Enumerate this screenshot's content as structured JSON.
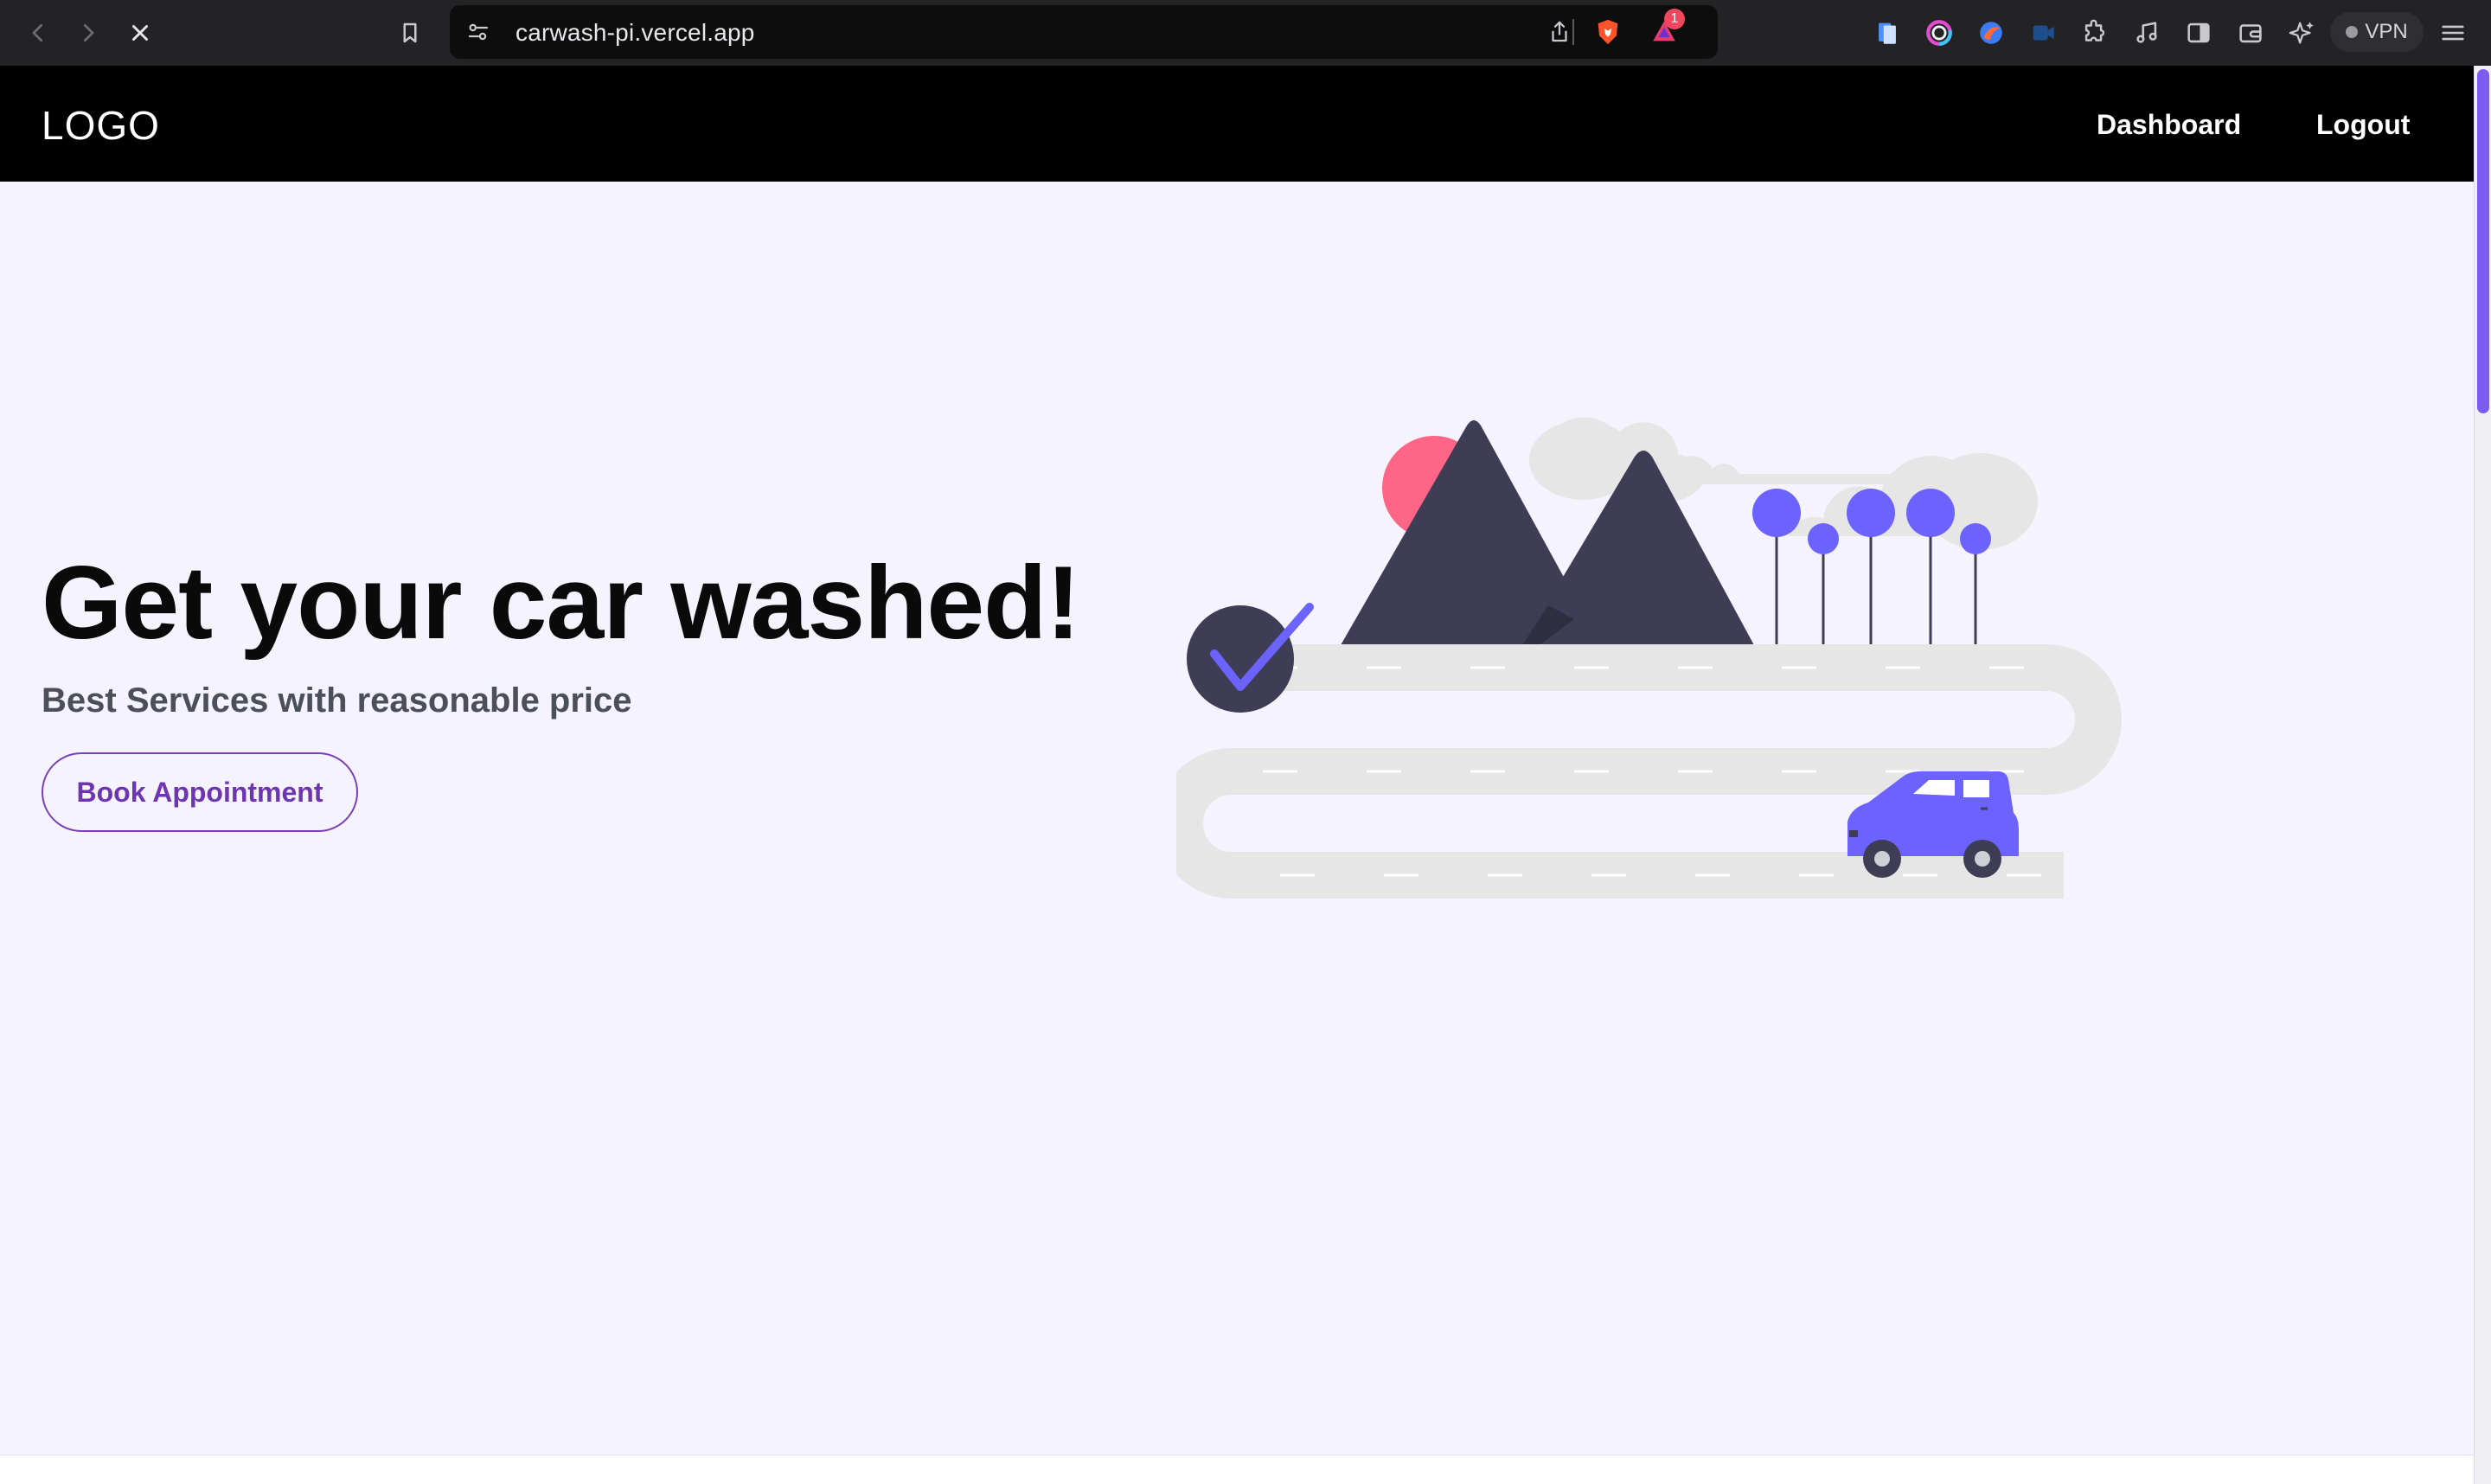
{
  "browser": {
    "url": "carwash-pi.vercel.app",
    "notification_count": "1",
    "vpn_label": "VPN",
    "icons": [
      "back-icon",
      "forward-icon",
      "stop-icon",
      "bookmark-icon",
      "site-settings-icon",
      "share-icon",
      "brave-shields-icon",
      "brave-rewards-icon",
      "extension-files-icon",
      "extension-color-icon",
      "extension-browser-icon",
      "extension-video-icon",
      "extensions-puzzle-icon",
      "music-icon",
      "sidebar-icon",
      "wallet-icon",
      "leo-ai-icon",
      "menu-icon"
    ]
  },
  "header": {
    "logo": "LOGO",
    "nav": {
      "dashboard": "Dashboard",
      "logout": "Logout"
    }
  },
  "hero": {
    "title": "Get your car washed!",
    "subtitle": "Best Services with reasonable price",
    "cta_label": "Book Appointment"
  },
  "colors": {
    "accent": "#6c63ff",
    "cta_text": "#6e35b0",
    "sun": "#ff6584",
    "mountain": "#3f3d56",
    "road": "#e6e6e6",
    "page_bg": "#f5f3fe",
    "header_bg": "#000000"
  }
}
